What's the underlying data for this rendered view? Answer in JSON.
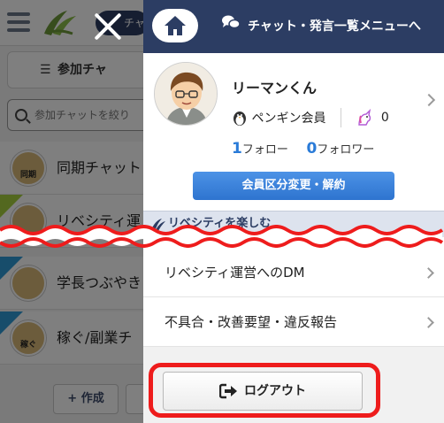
{
  "background": {
    "chat_pill_label": "チャ",
    "tab_label": "参加チャ",
    "search_placeholder": "参加チャットを絞り",
    "rows": [
      {
        "label": "同期チャット",
        "flag": "none"
      },
      {
        "label": "リベシティ運",
        "flag": "DM"
      },
      {
        "label": "学長つぶやき",
        "flag": "LC"
      },
      {
        "label": "稼ぐ/副業チ",
        "flag": "LC"
      }
    ],
    "create_label": "+ 作成",
    "avatar_badge": "同期",
    "avatar_badge_2": "稼ぐ"
  },
  "drawer": {
    "header_link": "チャット・発言一覧メニューへ",
    "user_name": "リーマンくん",
    "member_type": "ペンギン会員",
    "unicorn_count": "0",
    "follow_count": "1",
    "follow_label": "フォロー",
    "follower_count": "0",
    "follower_label": "フォロワー",
    "plan_button": "会員区分変更・解約",
    "section_title": "リベシティを楽しむ",
    "menu_items": [
      {
        "label": "リベシティ運営へのDM"
      },
      {
        "label": "不具合・改善要望・違反報告"
      }
    ],
    "logout_label": "ログアウト"
  },
  "colors": {
    "navy": "#2c3d63",
    "blue_button": "#3a84dd",
    "follow_blue": "#2a7bd8",
    "highlight_red": "#ee1c1c",
    "section_bg": "#dde3ee"
  }
}
